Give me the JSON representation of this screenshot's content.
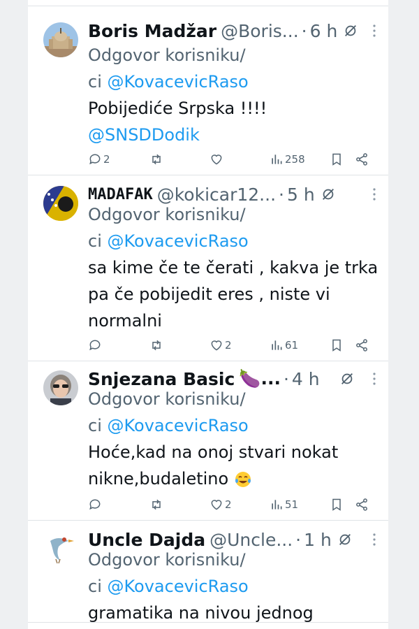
{
  "reply_prefix": "Odgovor korisniku/",
  "reply_mention_line": "ci ",
  "reply_mention": "@KovacevicRaso",
  "tweets": [
    {
      "name": "Boris Madžar",
      "handle": "@Boris...",
      "dot": "·",
      "time": "6 h",
      "body_lines": [
        "Pobijediće Srpska !!!!"
      ],
      "body_mention": "@SNSDDodik",
      "replies": "2",
      "retweets": "",
      "likes": "",
      "views": "258",
      "avatar_icon": "church-avatar-icon"
    },
    {
      "name": "MADAFAK",
      "handle": "@kokicar12...",
      "dot": "·",
      "time": "5 h",
      "body_lines": [
        "sa kime če te čerati , kakva je trka",
        "pa če pobijedit eres , niste vi",
        "normalni"
      ],
      "replies": "",
      "retweets": "",
      "likes": "2",
      "views": "61",
      "avatar_icon": "flag-avatar-icon"
    },
    {
      "name": "Snjezana Basic",
      "name_suffix": "🍆...",
      "handle": "",
      "dot": "·",
      "time": "4 h",
      "body_lines": [
        "Hoće,kad na onoj stvari nokat",
        "nikne,budaletino"
      ],
      "replies": "",
      "retweets": "",
      "likes": "2",
      "views": "51",
      "avatar_icon": "woman-avatar-icon"
    },
    {
      "name": "Uncle Dajda",
      "handle": "@Uncle...",
      "dot": "·",
      "time": "1 h",
      "body_lines": [
        "gramatika na nivou jednog"
      ],
      "avatar_icon": "bird-avatar-icon"
    }
  ],
  "colors": {
    "accent": "#1d9bf0",
    "muted": "#536471",
    "text": "#0f1419"
  }
}
